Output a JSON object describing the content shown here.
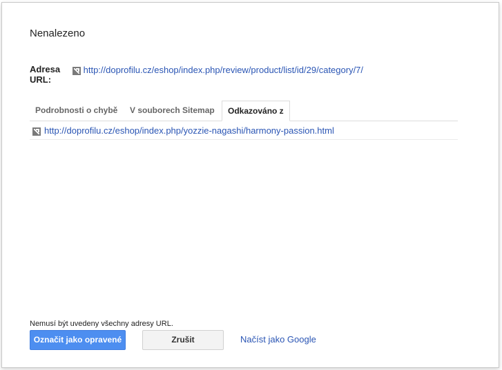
{
  "dialog": {
    "title": "Nenalezeno",
    "url_label": "Adresa URL:",
    "url_value": "http://doprofilu.cz/eshop/index.php/review/product/list/id/29/category/7/",
    "tabs": [
      {
        "label": "Podrobnosti o chybě",
        "active": false
      },
      {
        "label": "V souborech Sitemap",
        "active": false
      },
      {
        "label": "Odkazováno z",
        "active": true
      }
    ],
    "linked_from": [
      {
        "url": "http://doprofilu.cz/eshop/index.php/yozzie-nagashi/harmony-passion.html"
      }
    ],
    "note": "Nemusí být uvedeny všechny adresy URL.",
    "buttons": {
      "mark_fixed": "Označit jako opravené",
      "cancel": "Zrušit",
      "fetch_as_google": "Načíst jako Google"
    },
    "icons": {
      "external_link": "external-link-icon"
    },
    "colors": {
      "link": "#2a55b4",
      "primary_button": "#4d8ef0"
    }
  }
}
